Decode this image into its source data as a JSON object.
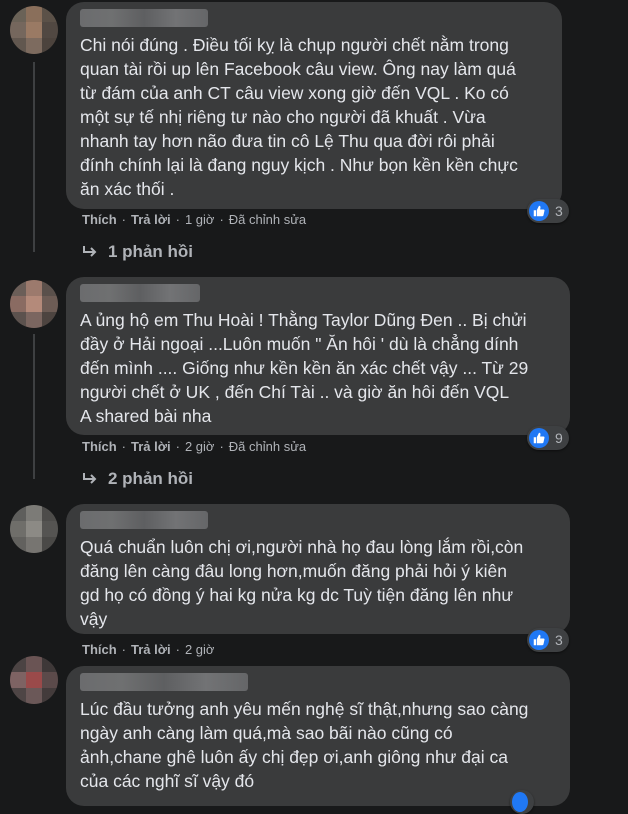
{
  "comments": [
    {
      "text": "Chi nói đúng . Điều tối kỵ là chụp người chết nằm trong\nquan tài rồi up lên Facebook câu view. Ông nay làm quá\ntừ đám của anh CT câu view xong giờ đến VQL . Ko có\nmột sự tế nhị riêng tư nào cho người đã khuất . Vừa\nnhanh tay hơn não đưa tin cô Lệ Thu qua đời rôi phải\nđính chính lại là đang nguy kịch . Như bọn kền kền chực\năn xác thối .",
      "like_count": "3",
      "like_label": "Thích",
      "reply_label": "Trả lời",
      "time": "1 giờ",
      "edited": "Đã chỉnh sửa",
      "replies_label": "1 phản hồi",
      "avatar_colors": [
        "#6a6257",
        "#8a6f5b",
        "#5b5148",
        "#75675d",
        "#9a7a64",
        "#514842",
        "#61574f",
        "#7d6b5f",
        "#4c433d"
      ]
    },
    {
      "text": "A ủng hộ em Thu Hoài ! Thằng Taylor Dũng Đen .. Bị chửi\nđầy ở Hải ngoại ...Luôn muốn \" Ăn hôi ' dù là chẳng dính\nđến mình .... Giống như kền kền ăn xác chết vậy ... Từ 29\nngười chết ở UK , đến Chí Tài .. và giờ ăn hôi đến VQL\nA shared bài nha",
      "like_count": "9",
      "like_label": "Thích",
      "reply_label": "Trả lời",
      "time": "2 giờ",
      "edited": "Đã chỉnh sửa",
      "replies_label": "2 phản hồi",
      "avatar_colors": [
        "#6b5e58",
        "#9c7a6d",
        "#5a504b",
        "#8a6b62",
        "#b48a7a",
        "#6d5c55",
        "#5c524e",
        "#7b6660",
        "#4d4440"
      ]
    },
    {
      "text": "Quá chuẩn luôn chị ơi,người nhà họ đau lòng lắm rồi,còn\nđăng lên càng đâu long hơn,muốn đăng phải hỏi ý kiên\ngd họ có đồng ý hai kg nửa kg dc Tuỳ tiện đăng lên như\nvậy",
      "like_count": "3",
      "like_label": "Thích",
      "reply_label": "Trả lời",
      "time": "2 giờ",
      "edited": "",
      "replies_label": "",
      "avatar_colors": [
        "#5e5e5c",
        "#7c7b77",
        "#4d4c4a",
        "#6f6e6a",
        "#8c8a85",
        "#555452",
        "#62615e",
        "#777571",
        "#4a4947"
      ]
    },
    {
      "text": "Lúc đầu tưởng anh yêu mến nghệ sĩ thật,nhưng sao càng\nngày anh càng làm quá,mà sao bãi nào cũng có\nảnh,chane ghê luôn ấy chị đẹp ơi,anh giông như đại ca\ncủa các nghĩ sĩ vậy đó",
      "like_count": "",
      "like_label": "",
      "reply_label": "",
      "time": "",
      "edited": "",
      "replies_label": "",
      "avatar_colors": [
        "#4b4343",
        "#6a5454",
        "#3e3838",
        "#7e6363",
        "#9a4a4a",
        "#5b4a4a",
        "#4e4545",
        "#6b5858",
        "#433b3b"
      ]
    }
  ],
  "colors": {
    "background": "#18191a",
    "bubble": "#3a3b3c",
    "like_blue": "#2078f4",
    "secondary_text": "#b0b3b8"
  }
}
